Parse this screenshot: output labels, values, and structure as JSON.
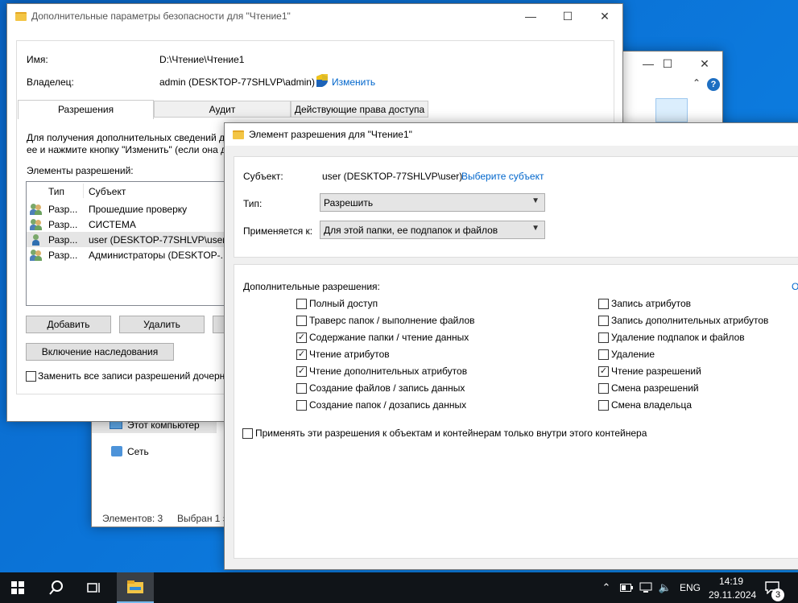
{
  "adv": {
    "title": "Дополнительные параметры безопасности  для \"Чтение1\"",
    "name_label": "Имя:",
    "name_value": "D:\\Чтение\\Чтение1",
    "owner_label": "Владелец:",
    "owner_value": "admin (DESKTOP-77SHLVP\\admin)",
    "change_link": "Изменить",
    "tabs": [
      "Разрешения",
      "Аудит",
      "Действующие права доступа"
    ],
    "info_line1": "Для получения дополнительных сведений д",
    "info_line2": "ее и нажмите кнопку \"Изменить\" (если она д",
    "entries_label": "Элементы разрешений:",
    "col_type": "Тип",
    "col_subject": "Субъект",
    "rows": [
      {
        "type": "Разр...",
        "subject": "Прошедшие проверку"
      },
      {
        "type": "Разр...",
        "subject": "СИСТЕМА"
      },
      {
        "type": "Разр...",
        "subject": "user (DESKTOP-77SHLVP\\user)"
      },
      {
        "type": "Разр...",
        "subject": "Администраторы (DESKTOP-..."
      }
    ],
    "add_btn": "Добавить",
    "remove_btn": "Удалить",
    "inherit_btn": "Включение наследования",
    "replace_label": "Заменить все записи разрешений дочерн"
  },
  "explorer": {
    "this_pc": "Этот компьютер",
    "network": "Сеть",
    "status_items": "Элементов: 3",
    "status_selected": "Выбран 1 э"
  },
  "perm": {
    "title": "Элемент разрешения для \"Чтение1\"",
    "subject_label": "Субъект:",
    "subject_value": "user (DESKTOP-77SHLVP\\user)",
    "select_subject": "Выберите субъект",
    "type_label": "Тип:",
    "type_value": "Разрешить",
    "applies_label": "Применяется к:",
    "applies_value": "Для этой папки, ее подпапок и файлов",
    "adv_perms_label": "Дополнительные разрешения:",
    "cut_link": "О",
    "left_perms": [
      {
        "label": "Полный доступ",
        "checked": false
      },
      {
        "label": "Траверс папок / выполнение файлов",
        "checked": false
      },
      {
        "label": "Содержание папки / чтение данных",
        "checked": true
      },
      {
        "label": "Чтение атрибутов",
        "checked": true
      },
      {
        "label": "Чтение дополнительных атрибутов",
        "checked": true
      },
      {
        "label": "Создание файлов / запись данных",
        "checked": false
      },
      {
        "label": "Создание папок / дозапись данных",
        "checked": false
      }
    ],
    "right_perms": [
      {
        "label": "Запись атрибутов",
        "checked": false
      },
      {
        "label": "Запись дополнительных атрибутов",
        "checked": false
      },
      {
        "label": "Удаление подпапок и файлов",
        "checked": false
      },
      {
        "label": "Удаление",
        "checked": false
      },
      {
        "label": "Чтение разрешений",
        "checked": true
      },
      {
        "label": "Смена разрешений",
        "checked": false
      },
      {
        "label": "Смена владельца",
        "checked": false
      }
    ],
    "apply_inside_label": "Применять эти разрешения к объектам и контейнерам только внутри этого контейнера"
  },
  "taskbar": {
    "lang": "ENG",
    "time": "14:19",
    "date": "29.11.2024",
    "notif_count": "3"
  }
}
